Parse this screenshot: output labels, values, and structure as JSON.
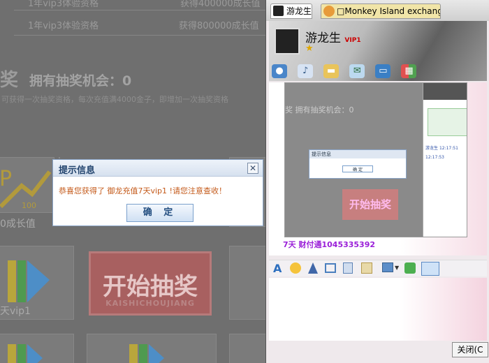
{
  "bg": {
    "row1_left": "1年vip3体验资格",
    "row1_right": "获得800000成长值",
    "row0_left": "1年vip3体验资格",
    "row0_right": "获得400000成长值",
    "lottery_prefix": "奖",
    "lottery_title": "拥有抽奖机会：",
    "lottery_count": "0",
    "lottery_note": "可获得一次抽奖资格，每次充值满4000金子，即增加一次抽奖资格",
    "tile_label_1": "0成长值",
    "tile_label_2": "天vip1",
    "start_button": "开始抽奖",
    "start_pinyin": "KAISHICHOUJIANG",
    "edge_label": "A"
  },
  "dialog": {
    "title": "提示信息",
    "close": "✕",
    "message": "恭喜您获得了 御龙充值7天vip1 !请您注意查收！",
    "ok": "确 定"
  },
  "chat": {
    "tab_active": "游龙生",
    "tab_other": "□Monkey Island exchange grou",
    "name": "游龙生",
    "vip": "VIP1",
    "star": "★",
    "message": "7天  财付通1045335392",
    "close_button": "关闭(C",
    "shot_sender": "游龙生",
    "shot_time1": "12:17:51",
    "shot_time2": "12:17:53",
    "shot_dialog_title": "提示信息",
    "shot_ok": "确 定",
    "shot_start": "开始抽奖",
    "shot_lottery": "奖  拥有抽奖机会：0"
  }
}
